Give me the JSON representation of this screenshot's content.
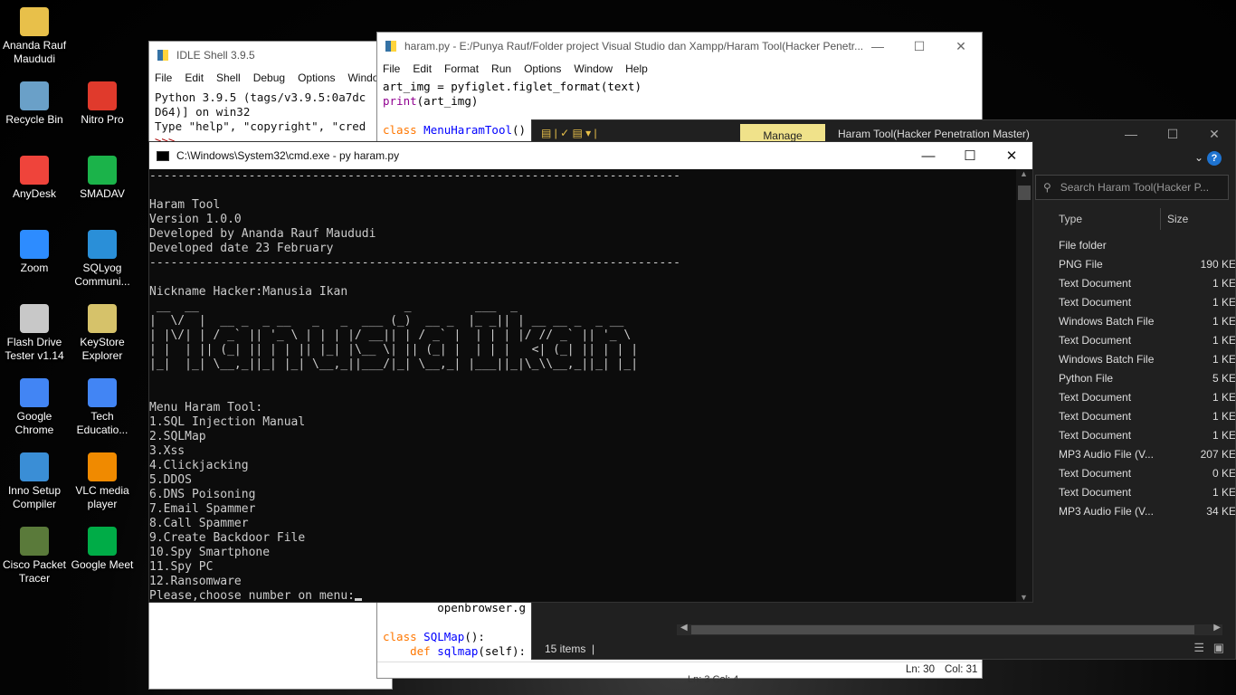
{
  "desktop_icons": [
    {
      "label": "Ananda Rauf Maududi",
      "icon": "user-folder-icon",
      "color": "#e8c04a"
    },
    {
      "label": "Recycle Bin",
      "icon": "recycle-bin-icon",
      "color": "#6aa0c8"
    },
    {
      "label": "Nitro Pro",
      "icon": "nitro-pro-icon",
      "color": "#e03a2c"
    },
    {
      "label": "AnyDesk",
      "icon": "anydesk-icon",
      "color": "#ef443b"
    },
    {
      "label": "SMADAV",
      "icon": "smadav-icon",
      "color": "#1bb34a"
    },
    {
      "label": "Zoom",
      "icon": "zoom-icon",
      "color": "#2d8cff"
    },
    {
      "label": "SQLyog Communi...",
      "icon": "sqlyog-icon",
      "color": "#2a8fd8"
    },
    {
      "label": "Flash Drive Tester v1.14",
      "icon": "flash-drive-icon",
      "color": "#c8c8c8"
    },
    {
      "label": "KeyStore Explorer",
      "icon": "keystore-icon",
      "color": "#d6c26a"
    },
    {
      "label": "Google Chrome",
      "icon": "chrome-icon",
      "color": "#4285f4"
    },
    {
      "label": "Tech Educatio...",
      "icon": "tech-education-icon",
      "color": "#4285f4"
    },
    {
      "label": "Inno Setup Compiler",
      "icon": "inno-setup-icon",
      "color": "#3a8ed6"
    },
    {
      "label": "VLC media player",
      "icon": "vlc-icon",
      "color": "#f08a00"
    },
    {
      "label": "Cisco Packet Tracer",
      "icon": "cisco-packet-tracer-icon",
      "color": "#5a7a3a"
    },
    {
      "label": "Google Meet",
      "icon": "google-meet-icon",
      "color": "#00ac47"
    }
  ],
  "idle": {
    "title": "IDLE Shell 3.9.5",
    "menu": [
      "File",
      "Edit",
      "Shell",
      "Debug",
      "Options",
      "Windo"
    ],
    "lines": [
      "Python 3.9.5 (tags/v3.9.5:0a7dc",
      "D64)] on win32",
      "Type \"help\", \"copyright\", \"cred",
      ">>>"
    ],
    "status": "Ln: 3   Col: 4"
  },
  "editor": {
    "title": "haram.py - E:/Punya Rauf/Folder project Visual Studio dan Xampp/Haram Tool(Hacker Penetr...",
    "menu": [
      "File",
      "Edit",
      "Format",
      "Run",
      "Options",
      "Window",
      "Help"
    ],
    "line1": "art_img = pyfiglet.figlet_format(text)",
    "line2_fn": "print",
    "line2_rest": "(art_img)",
    "line4_kw": "class",
    "line4_name": "MenuHaramTool",
    "line4_rest": "()",
    "bottom_line1": "        openbrowser.g",
    "bottom_kw": "class",
    "bottom_name": "SQLMap",
    "bottom_rest": "():",
    "bottom_def": "def",
    "bottom_fn": "sqlmap",
    "bottom_args": "(self):",
    "ln": "Ln: 30",
    "col": "Col: 31"
  },
  "explorer": {
    "manage": "Manage",
    "title": "Haram Tool(Hacker Penetration Master)",
    "search_placeholder": "Search Haram Tool(Hacker P...",
    "col_type": "Type",
    "col_size": "Size",
    "rows": [
      {
        "type": "File folder",
        "size": ""
      },
      {
        "type": "PNG File",
        "size": "190 KE"
      },
      {
        "type": "Text Document",
        "size": "1 KE"
      },
      {
        "type": "Text Document",
        "size": "1 KE"
      },
      {
        "type": "Windows Batch File",
        "size": "1 KE"
      },
      {
        "type": "Text Document",
        "size": "1 KE"
      },
      {
        "type": "Windows Batch File",
        "size": "1 KE"
      },
      {
        "type": "Python File",
        "size": "5 KE"
      },
      {
        "type": "Text Document",
        "size": "1 KE"
      },
      {
        "type": "Text Document",
        "size": "1 KE"
      },
      {
        "type": "Text Document",
        "size": "1 KE"
      },
      {
        "type": "MP3 Audio File (V...",
        "size": "207 KE"
      },
      {
        "type": "Text Document",
        "size": "0 KE"
      },
      {
        "type": "Text Document",
        "size": "1 KE"
      },
      {
        "type": "MP3 Audio File (V...",
        "size": "34 KE"
      }
    ],
    "status": "15 items"
  },
  "cmd": {
    "title": "C:\\Windows\\System32\\cmd.exe - py  haram.py",
    "separator": "---------------------------------------------------------------------------",
    "tool_name": "Haram Tool",
    "version": "Version 1.0.0",
    "developer": "Developed by Ananda Rauf Maududi",
    "date": "Developed date 23 February",
    "nickname": "Nickname Hacker:Manusia Ikan",
    "ascii_art": " __  __                             _         ___  _                 \n|  \\/  |  __ _  _ __   _   _  ___ (_)  __ _  |_ _|| | __ __ _  _ __  \n| |\\/| | / _` || '_ \\ | | | |/ __|| | / _` |  | | | |/ // _` || '_ \\ \n| |  | || (_| || | | || |_| |\\__ \\| || (_| |  | | |   <| (_| || | | |\n|_|  |_| \\__,_||_| |_| \\__,_||___/|_| \\__,_| |___||_|\\_\\\\__,_||_| |_|",
    "menu_title": "Menu Haram Tool:",
    "menu_items": [
      "1.SQL Injection Manual",
      "2.SQLMap",
      "3.Xss",
      "4.Clickjacking",
      "5.DDOS",
      "6.DNS Poisoning",
      "7.Email Spammer",
      "8.Call Spammer",
      "9.Create Backdoor File",
      "10.Spy Smartphone",
      "11.Spy PC",
      "12.Ransomware"
    ],
    "prompt": "Please,choose number on menu:"
  }
}
